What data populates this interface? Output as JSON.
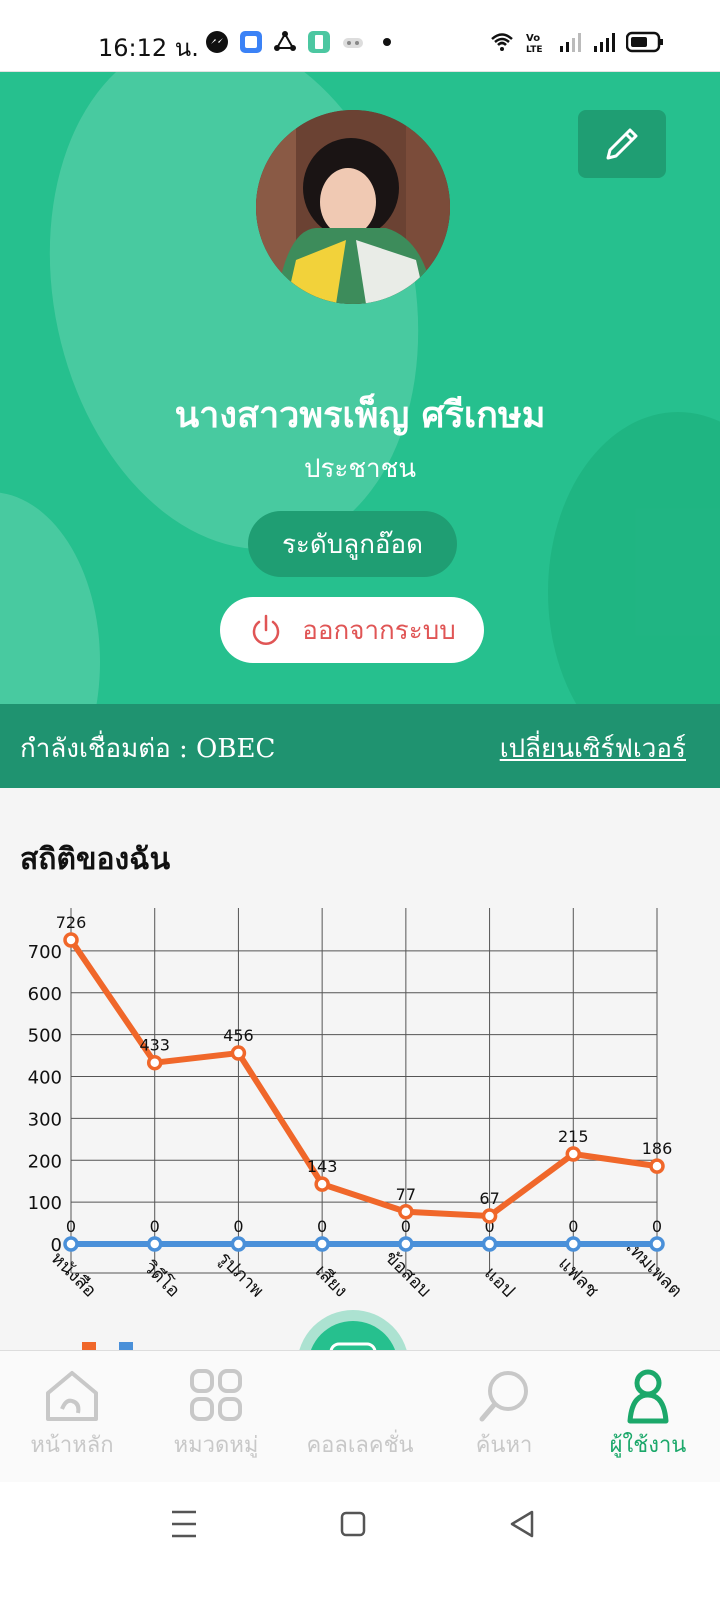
{
  "status_bar": {
    "time": "16:12 น.",
    "left_icons": [
      "messenger-icon",
      "app-icon",
      "share-icon",
      "app2-icon",
      "game-icon",
      "dot-icon"
    ],
    "right_icons": [
      "wifi-icon",
      "volte-icon",
      "signal-icon",
      "signal2-icon",
      "battery-icon"
    ]
  },
  "profile": {
    "name": "นางสาวพรเพ็ญ ศรีเกษม",
    "role": "ประชาชน",
    "level": "ระดับลูกอ๊อด",
    "logout_label": "ออกจากระบบ",
    "edit_icon": "pencil-icon"
  },
  "server": {
    "label": "กำลังเชื่อมต่อ : OBEC",
    "switch_label": "เปลี่ยนเซิร์ฟเวอร์"
  },
  "stats": {
    "title": "สถิติของฉัน"
  },
  "chart_data": {
    "type": "line",
    "categories": [
      "หนังสือ",
      "วิดีโอ",
      "รูปภาพ",
      "เสียง",
      "ข้อสอบ",
      "แอป",
      "แฟลช",
      "เทมเพลต"
    ],
    "series": [
      {
        "color": "#f0672a",
        "values": [
          726,
          433,
          456,
          143,
          77,
          67,
          215,
          186
        ]
      },
      {
        "color": "#4a90d9",
        "values": [
          0,
          0,
          0,
          0,
          0,
          0,
          0,
          0
        ]
      }
    ],
    "yticks": [
      0,
      100,
      200,
      300,
      400,
      500,
      600,
      700
    ],
    "ylim": [
      0,
      726
    ],
    "grid": true
  },
  "bottom_nav": {
    "items": [
      {
        "label": "หน้าหลัก",
        "icon": "home-icon"
      },
      {
        "label": "หมวดหมู่",
        "icon": "category-icon"
      },
      {
        "label": "คอลเลคชั่น",
        "icon": "collection-icon"
      },
      {
        "label": "ค้นหา",
        "icon": "search-icon"
      },
      {
        "label": "ผู้ใช้งาน",
        "icon": "user-icon"
      }
    ]
  },
  "colors": {
    "brand": "#26c08e",
    "brand_dark": "#1f9e73",
    "active": "#1ba86a",
    "logout": "#e05555"
  }
}
